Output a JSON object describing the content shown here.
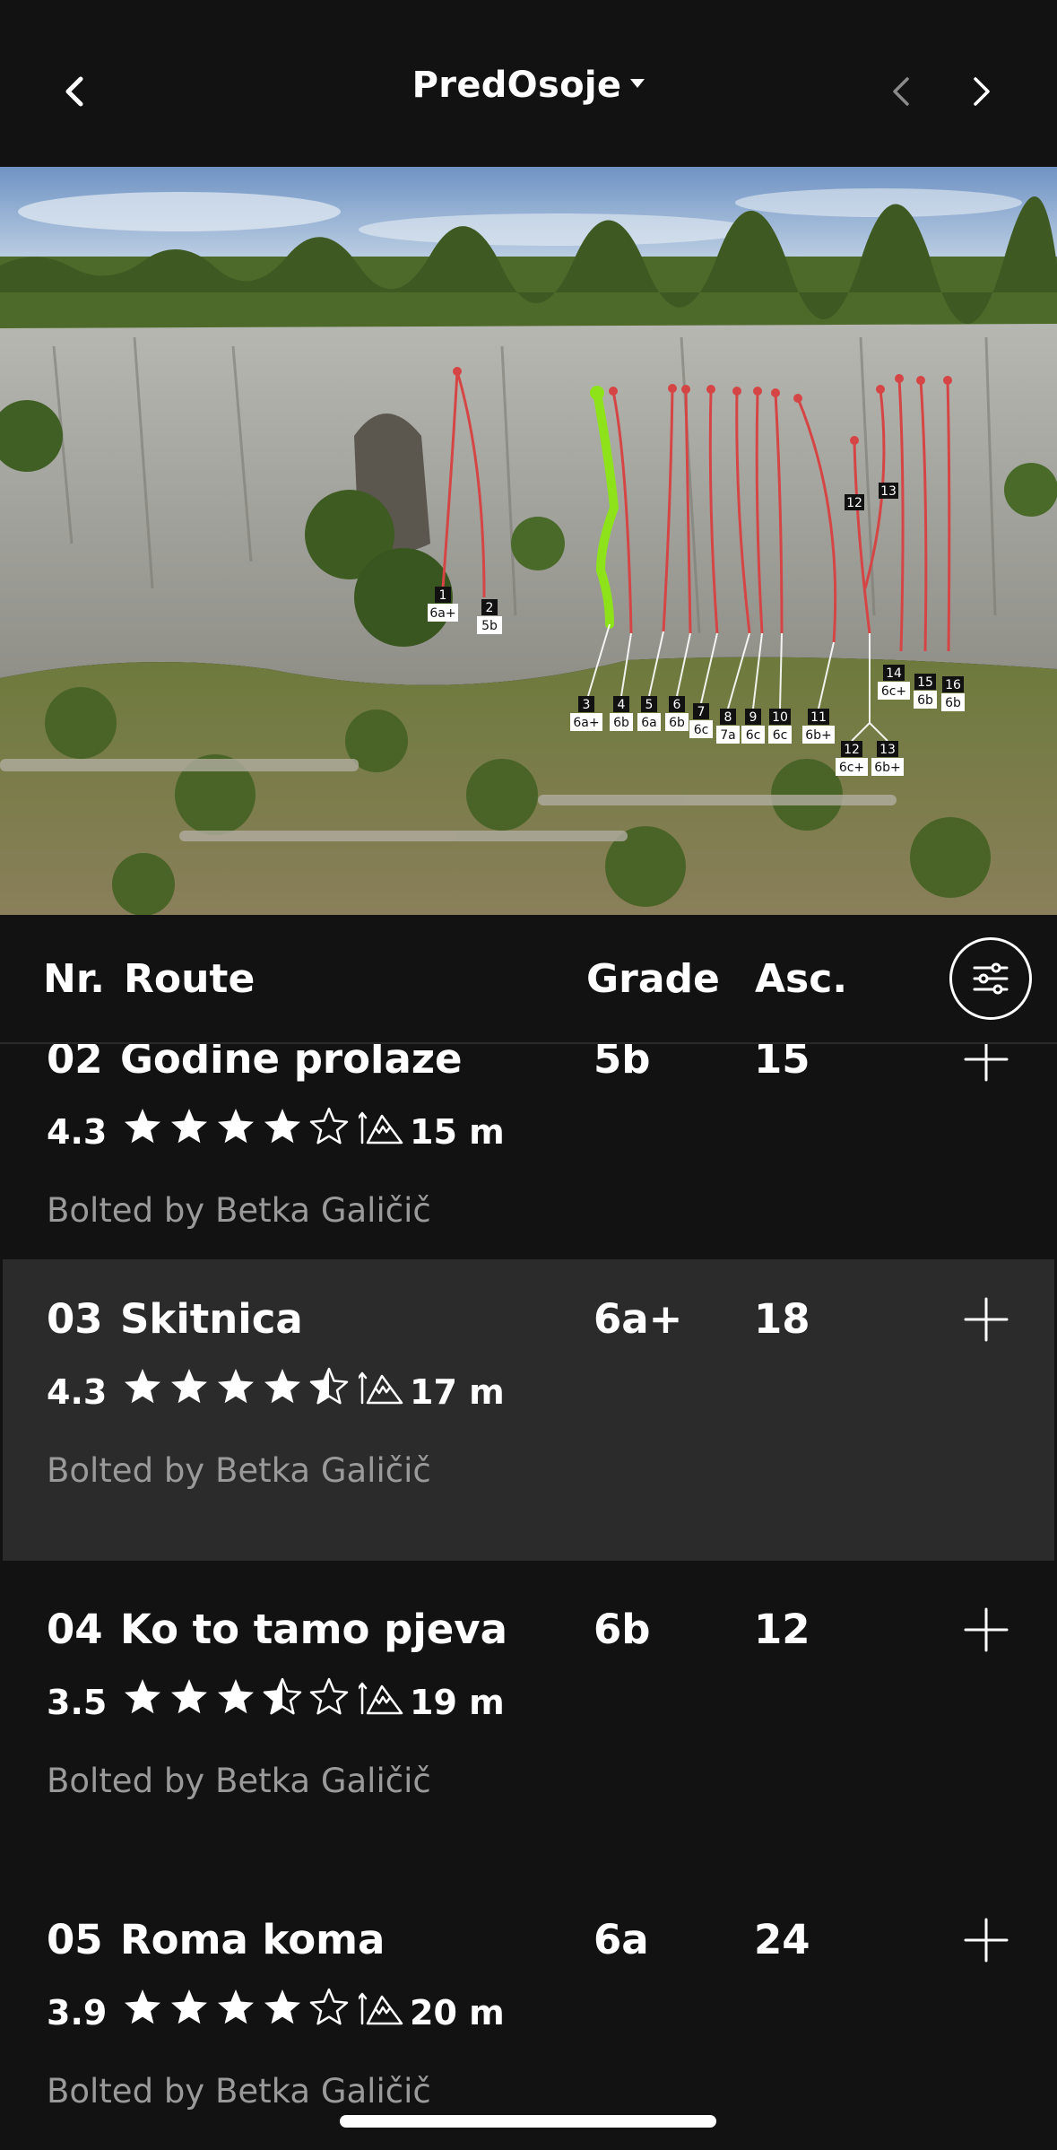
{
  "header": {
    "title": "PredOsoje"
  },
  "topo": {
    "route_labels": [
      {
        "nr": "1",
        "grade": "6a+"
      },
      {
        "nr": "2",
        "grade": "5b"
      },
      {
        "nr": "3",
        "grade": "6a+"
      },
      {
        "nr": "4",
        "grade": "6b"
      },
      {
        "nr": "5",
        "grade": "6a"
      },
      {
        "nr": "6",
        "grade": "6b"
      },
      {
        "nr": "7",
        "grade": "6c"
      },
      {
        "nr": "8",
        "grade": "7a"
      },
      {
        "nr": "9",
        "grade": "6c"
      },
      {
        "nr": "10",
        "grade": "6c"
      },
      {
        "nr": "11",
        "grade": "6b+"
      },
      {
        "nr": "12",
        "grade": "6c+"
      },
      {
        "nr": "13",
        "grade": "6b+"
      },
      {
        "nr": "14",
        "grade": "6c+"
      },
      {
        "nr": "15",
        "grade": "6b"
      },
      {
        "nr": "16",
        "grade": "6b"
      }
    ],
    "highlighted_route": "3",
    "colors": {
      "route_line": "#d64545",
      "highlight_line": "#8ee21a"
    }
  },
  "columns": {
    "nr": "Nr.",
    "route": "Route",
    "grade": "Grade",
    "asc": "Asc."
  },
  "routes": [
    {
      "nr": "02",
      "name": "Godine prolaze",
      "grade": "5b",
      "asc": "15",
      "rating": "4.3",
      "stars": 4,
      "length": "15 m",
      "bolted": "Bolted by Betka Galičič",
      "selected": false
    },
    {
      "nr": "03",
      "name": "Skitnica",
      "grade": "6a+",
      "asc": "18",
      "rating": "4.3",
      "stars": 4.5,
      "length": "17 m",
      "bolted": "Bolted by Betka Galičič",
      "selected": true
    },
    {
      "nr": "04",
      "name": "Ko to tamo pjeva",
      "grade": "6b",
      "asc": "12",
      "rating": "3.5",
      "stars": 3.5,
      "length": "19 m",
      "bolted": "Bolted by Betka Galičič",
      "selected": false
    },
    {
      "nr": "05",
      "name": "Roma koma",
      "grade": "6a",
      "asc": "24",
      "rating": "3.9",
      "stars": 4,
      "length": "20 m",
      "bolted": "Bolted by Betka Galičič",
      "selected": false
    }
  ],
  "icons": {
    "back": "chevron-left-icon",
    "prev": "chevron-left-icon",
    "next": "chevron-right-icon",
    "filter": "sliders-icon",
    "add": "plus-icon",
    "length": "mountain-height-icon"
  }
}
